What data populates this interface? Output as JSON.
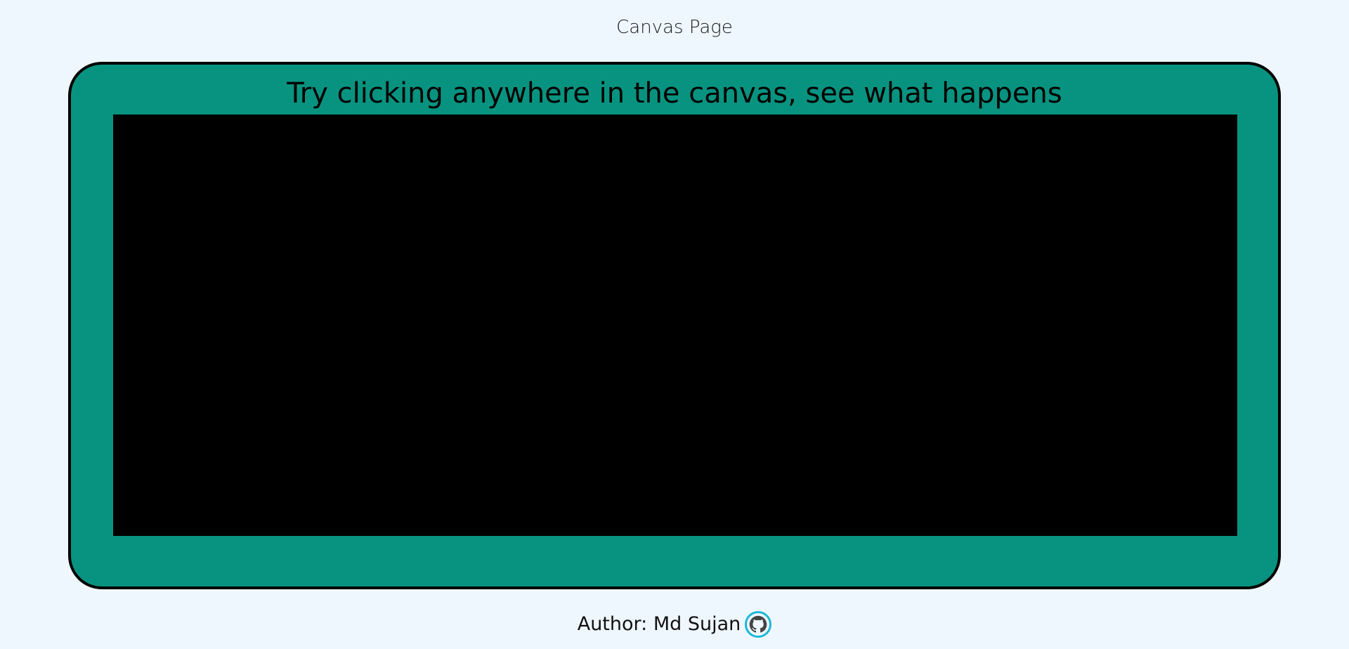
{
  "page": {
    "title": "Canvas Page"
  },
  "canvas_panel": {
    "instruction": "Try clicking anywhere in the canvas, see what happens"
  },
  "footer": {
    "author_label": "Author: Md Sujan",
    "profile_icon": "github-icon"
  },
  "colors": {
    "background": "#eff7fe",
    "panel": "#089380",
    "canvas": "#000000",
    "icon_ring": "#1ab8d6"
  }
}
